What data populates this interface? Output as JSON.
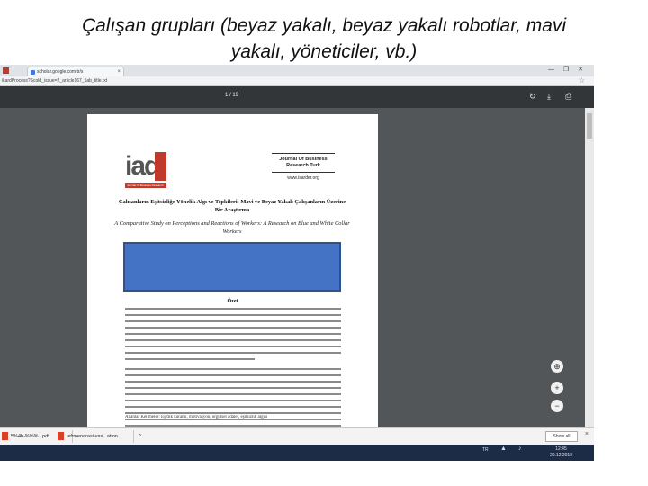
{
  "slide": {
    "title_line1": "Çalışan grupları (beyaz yakalı,  beyaz yakalı robotlar, mavi",
    "title_line2": "yakalı, yöneticiler, vb.)"
  },
  "browser": {
    "tab_title": "scholar.google.com.tr/s",
    "tab_close": "×",
    "url": "ikardProcess?Scold_issue=2_article167_5ab_title.txt",
    "window_buttons": "— ❐ ✕"
  },
  "pdf_viewer": {
    "page_count": "1 / 19",
    "rotate_icon": "↻",
    "download_icon": "⤓",
    "print_icon": "⎙"
  },
  "document": {
    "logo_text": "iad",
    "logo_strip": "Journal Of Business Research",
    "journal_name": "Journal Of Business Research Turk",
    "journal_site": "www.isarder.org",
    "title_tr": "Çalışanların Eşitsizliğe Yönelik Algı ve Tepkileri: Mavi ve Beyaz Yakalı Çalışanların Üzerine Bir Araştırma",
    "title_en": "A Comparative Study on Perceptions and Reactions of Workers: A Research on Blue and White Collar Workers",
    "abstract_heading": "Özet",
    "keywords": "Anahtar Kelimeler: Eşitlik kuramı, motivasyon, örgütsel adalet, eşitsizlik algısı"
  },
  "zoom": {
    "fit_icon": "⊕",
    "zoom_in": "+",
    "zoom_out": "−"
  },
  "downloads": {
    "items": [
      "5%4b-%%%...pdf",
      "tezmenarasi-vas...ation"
    ],
    "caret": "^",
    "show_all": "Show all",
    "close": "×"
  },
  "taskbar": {
    "lang": "TR",
    "time": "12:45",
    "date": "20.12.2018"
  }
}
